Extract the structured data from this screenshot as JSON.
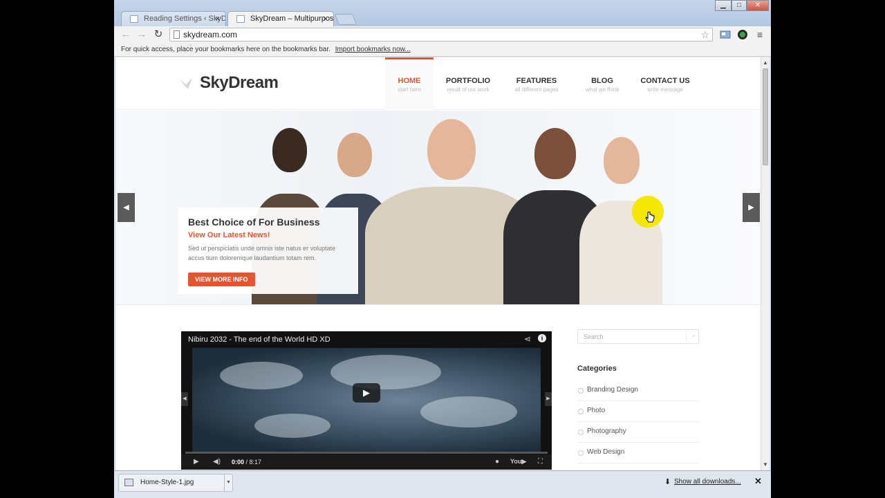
{
  "browser": {
    "tabs": [
      {
        "title": "Reading Settings ‹ SkyDre",
        "active": false
      },
      {
        "title": "SkyDream – Multipurpose",
        "active": true
      }
    ],
    "close_glyph": "×",
    "url": "skydream.com",
    "bookmarks_bar_text": "For quick access, place your bookmarks here on the bookmarks bar.",
    "import_link": "Import bookmarks now..."
  },
  "site": {
    "logo": "SkyDream",
    "menu": [
      {
        "label": "HOME",
        "sub": "start here"
      },
      {
        "label": "PORTFOLIO",
        "sub": "result of our work"
      },
      {
        "label": "FEATURES",
        "sub": "all different pages"
      },
      {
        "label": "BLOG",
        "sub": "what we think"
      },
      {
        "label": "CONTACT US",
        "sub": "write message"
      }
    ],
    "accent_color": "#e3562f"
  },
  "hero": {
    "caption_title": "Best Choice of For Business",
    "caption_subtitle": "View Our Latest News!",
    "caption_text": "Sed ut perspiciatis unde omnis iste natus er voluptate accus tium doloremque laudantium totam rem.",
    "button_label": "VIEW MORE INFO"
  },
  "video": {
    "title": "Nibiru 2032 - The end of the World HD XD",
    "current_time": "0:00",
    "duration": "/ 8:17"
  },
  "sidebar": {
    "search_placeholder": "Search",
    "categories_title": "Categories",
    "categories": [
      "Branding Design",
      "Photo",
      "Photography",
      "Web Design"
    ]
  },
  "downloads": {
    "file": "Home-Style-1.jpg",
    "show_all": "Show all downloads..."
  }
}
